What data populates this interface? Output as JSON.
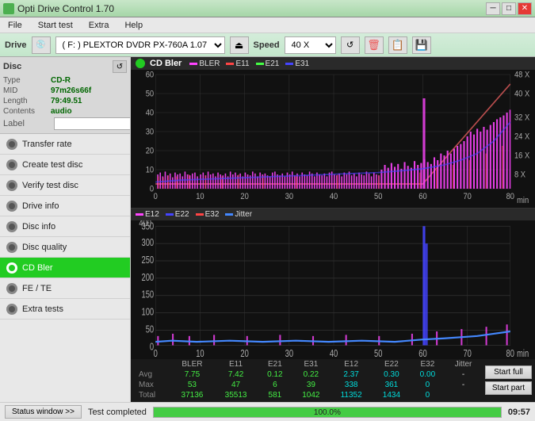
{
  "titlebar": {
    "title": "Opti Drive Control 1.70",
    "icon": "app-icon",
    "minimize": "─",
    "maximize": "□",
    "close": "✕"
  },
  "menubar": {
    "items": [
      "File",
      "Start test",
      "Extra",
      "Help"
    ]
  },
  "toolbar": {
    "drive_label": "Drive",
    "drive_value": "(F:)  PLEXTOR DVDR  PX-760A 1.07",
    "speed_label": "Speed",
    "speed_value": "40 X"
  },
  "sidebar": {
    "disc_title": "Disc",
    "disc_info": {
      "type_label": "Type",
      "type_value": "CD-R",
      "mid_label": "MID",
      "mid_value": "97m26s66f",
      "length_label": "Length",
      "length_value": "79:49.51",
      "contents_label": "Contents",
      "contents_value": "audio",
      "label_label": "Label"
    },
    "nav_items": [
      {
        "id": "transfer-rate",
        "label": "Transfer rate",
        "active": false
      },
      {
        "id": "create-test-disc",
        "label": "Create test disc",
        "active": false
      },
      {
        "id": "verify-test-disc",
        "label": "Verify test disc",
        "active": false
      },
      {
        "id": "drive-info",
        "label": "Drive info",
        "active": false
      },
      {
        "id": "disc-info",
        "label": "Disc info",
        "active": false
      },
      {
        "id": "disc-quality",
        "label": "Disc quality",
        "active": false
      },
      {
        "id": "cd-bler",
        "label": "CD Bler",
        "active": true
      },
      {
        "id": "fe-te",
        "label": "FE / TE",
        "active": false
      },
      {
        "id": "extra-tests",
        "label": "Extra tests",
        "active": false
      }
    ]
  },
  "chart_top": {
    "title": "CD Bler",
    "legend": [
      {
        "label": "BLER",
        "color": "#ff00ff"
      },
      {
        "label": "E11",
        "color": "#ff4444"
      },
      {
        "label": "E21",
        "color": "#44ff44"
      },
      {
        "label": "E31",
        "color": "#4444ff"
      }
    ],
    "y_axis": [
      0,
      10,
      20,
      30,
      40,
      50,
      60
    ],
    "x_axis": [
      0,
      10,
      20,
      30,
      40,
      50,
      60,
      70,
      80
    ],
    "right_axis": [
      "48 X",
      "40 X",
      "32 X",
      "24 X",
      "16 X",
      "8 X"
    ]
  },
  "chart_bottom": {
    "legend": [
      {
        "label": "E12",
        "color": "#ff00ff"
      },
      {
        "label": "E22",
        "color": "#4444ff"
      },
      {
        "label": "E32",
        "color": "#ff4444"
      },
      {
        "label": "Jitter",
        "color": "#4488ff"
      }
    ],
    "y_axis": [
      0,
      50,
      100,
      150,
      200,
      250,
      300,
      350,
      400
    ],
    "x_axis": [
      0,
      10,
      20,
      30,
      40,
      50,
      60,
      70,
      80
    ]
  },
  "data_table": {
    "headers": [
      "",
      "BLER",
      "E11",
      "E21",
      "E31",
      "E12",
      "E22",
      "E32",
      "Jitter"
    ],
    "rows": [
      {
        "label": "Avg",
        "values": [
          "7.75",
          "7.42",
          "0.12",
          "0.22",
          "2.37",
          "0.30",
          "0.00",
          "-"
        ]
      },
      {
        "label": "Max",
        "values": [
          "53",
          "47",
          "6",
          "39",
          "338",
          "361",
          "0",
          "-"
        ]
      },
      {
        "label": "Total",
        "values": [
          "37136",
          "35513",
          "581",
          "1042",
          "11352",
          "1434",
          "0",
          ""
        ]
      }
    ],
    "buttons": {
      "start_full": "Start full",
      "start_part": "Start part"
    }
  },
  "statusbar": {
    "window_button": "Status window >>",
    "status_text": "Test completed",
    "progress": 100.0,
    "progress_label": "100.0%",
    "time": "09:57"
  }
}
